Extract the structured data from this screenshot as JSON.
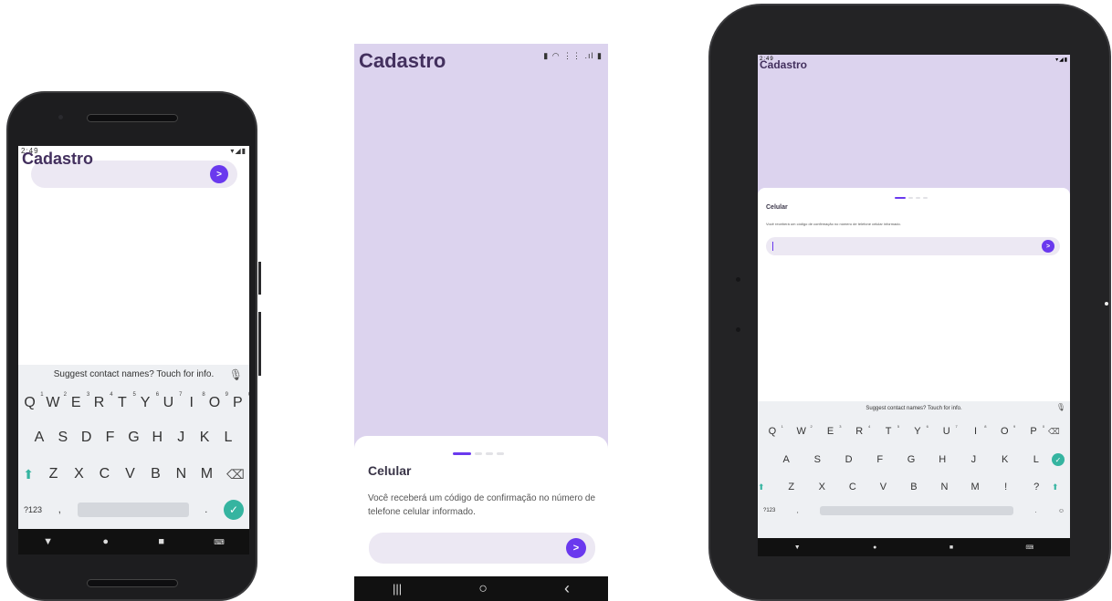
{
  "app": {
    "title": "Cadastro"
  },
  "phone_left": {
    "status_time": "2:49",
    "status_right": "▾◢▮",
    "send_label": ">",
    "keyboard": {
      "suggestion": "Suggest contact names? Touch for info.",
      "row1": [
        {
          "key": "Q",
          "alt": "1"
        },
        {
          "key": "W",
          "alt": "2"
        },
        {
          "key": "E",
          "alt": "3"
        },
        {
          "key": "R",
          "alt": "4"
        },
        {
          "key": "T",
          "alt": "5"
        },
        {
          "key": "Y",
          "alt": "6"
        },
        {
          "key": "U",
          "alt": "7"
        },
        {
          "key": "I",
          "alt": "8"
        },
        {
          "key": "O",
          "alt": "9"
        },
        {
          "key": "P",
          "alt": "0"
        }
      ],
      "row2": [
        "A",
        "S",
        "D",
        "F",
        "G",
        "H",
        "J",
        "K",
        "L"
      ],
      "row3": [
        "Z",
        "X",
        "C",
        "V",
        "B",
        "N",
        "M"
      ],
      "numbers_label": "?123",
      "comma_label": ",",
      "period_label": "."
    }
  },
  "phone_middle": {
    "status_right": "▮ ◠ ⋮⋮ .ıl ▮",
    "sheet": {
      "title": "Celular",
      "description": "Você receberá um código de confirmação no número de telefone celular informado.",
      "send_label": ">"
    },
    "nav": {
      "recent": "|||",
      "home": "○",
      "back": "‹"
    }
  },
  "tablet": {
    "status_time": "2:49",
    "status_right": "▾◢▮",
    "sheet": {
      "title": "Celular",
      "description": "Você receberá um código de confirmação no número de telefone celular informado.",
      "send_label": ">"
    },
    "keyboard": {
      "suggestion": "Suggest contact names? Touch for info.",
      "row1": [
        {
          "key": "Q",
          "alt": "1"
        },
        {
          "key": "W",
          "alt": "2"
        },
        {
          "key": "E",
          "alt": "3"
        },
        {
          "key": "R",
          "alt": "4"
        },
        {
          "key": "T",
          "alt": "5"
        },
        {
          "key": "Y",
          "alt": "6"
        },
        {
          "key": "U",
          "alt": "7"
        },
        {
          "key": "I",
          "alt": "8"
        },
        {
          "key": "O",
          "alt": "9"
        },
        {
          "key": "P",
          "alt": "0"
        }
      ],
      "row2": [
        "A",
        "S",
        "D",
        "F",
        "G",
        "H",
        "J",
        "K",
        "L"
      ],
      "row3": [
        "Z",
        "X",
        "C",
        "V",
        "B",
        "N",
        "M",
        "!",
        "?"
      ],
      "numbers_label": "?123",
      "comma_label": ",",
      "period_label": ".",
      "emoji_label": "☺"
    }
  },
  "colors": {
    "accent": "#6a39ee",
    "title": "#43305e",
    "background_lavender": "#dcd3ee",
    "input_fill": "#ece8f3",
    "keyboard_teal": "#35b4a0"
  }
}
